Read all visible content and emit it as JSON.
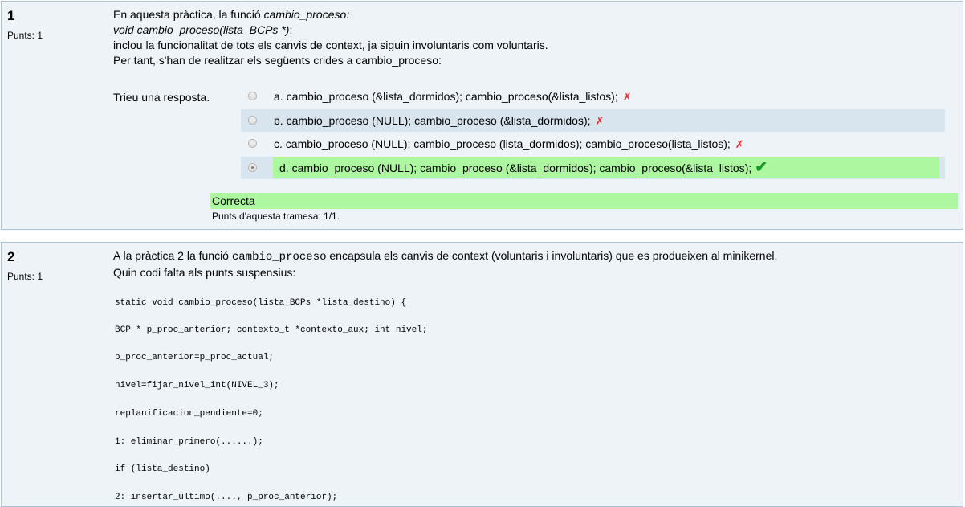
{
  "q1": {
    "number": "1",
    "points": "Punts: 1",
    "text": {
      "line1_prefix": "En aquesta pràctica, la funció ",
      "line1_italic": "cambio_proceso:",
      "line2_italic": "void cambio_proceso(lista_BCPs *)",
      "line2_suffix": ":",
      "line3": "inclou la funcionalitat de tots els canvis de context, ja siguin involuntaris com voluntaris.",
      "line4": "Per tant, s'han de realitzar els següents crides a cambio_proceso:"
    },
    "prompt": "Trieu una resposta.",
    "options": [
      {
        "label": "a. cambio_proceso (&lista_dormidos); cambio_proceso(&lista_listos);",
        "mark": "✗"
      },
      {
        "label": "b. cambio_proceso (NULL); cambio_proceso (&lista_dormidos);",
        "mark": "✗"
      },
      {
        "label": "c. cambio_proceso (NULL); cambio_proceso (lista_dormidos); cambio_proceso(lista_listos);",
        "mark": "✗"
      },
      {
        "label": "d. cambio_proceso (NULL); cambio_proceso (&lista_dormidos); cambio_proceso(&lista_listos);",
        "mark": "✔"
      }
    ],
    "feedback": "Correcta",
    "grade": "Punts d'aquesta tramesa: 1/1."
  },
  "q2": {
    "number": "2",
    "points": "Punts: 1",
    "text": {
      "line1_prefix": "A la pràctica 2 la funció ",
      "line1_code": "cambio_proceso",
      "line1_suffix": " encapsula els canvis de context (voluntaris i involuntaris) que es produeixen al minikernel.",
      "line2": "Quin codi falta als punts suspensius:"
    },
    "code": [
      "static void cambio_proceso(lista_BCPs *lista_destino) {",
      "BCP * p_proc_anterior; contexto_t *contexto_aux; int nivel;",
      "p_proc_anterior=p_proc_actual;",
      "nivel=fijar_nivel_int(NIVEL_3);",
      "replanificacion_pendiente=0;",
      "1: eliminar_primero(......);",
      "if (lista_destino)",
      "2: insertar_ultimo(...., p_proc_anterior);"
    ]
  }
}
